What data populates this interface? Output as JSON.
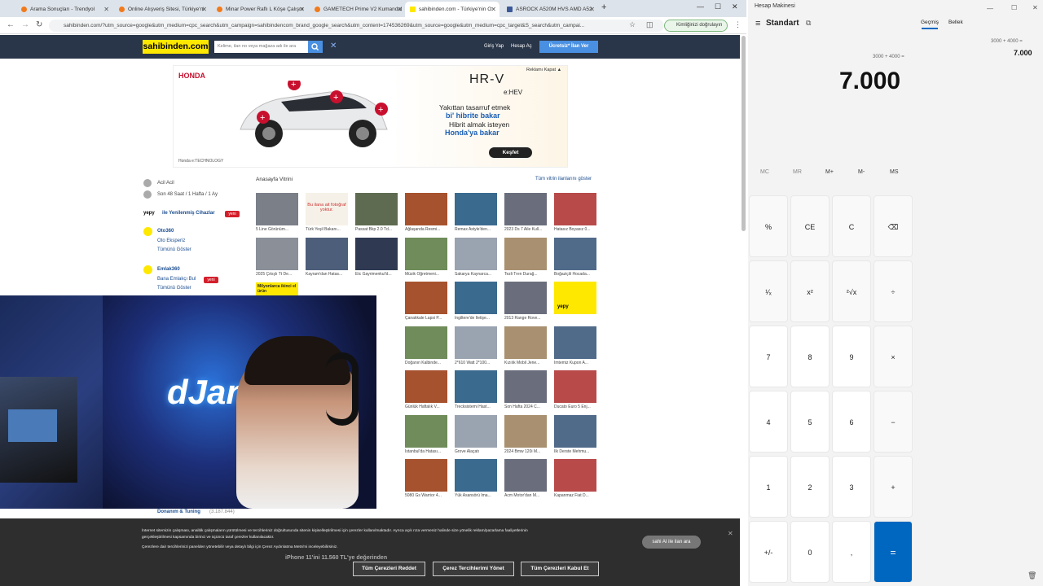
{
  "browser": {
    "tabs": [
      {
        "label": "Arama Sonuçları - Trendyol",
        "color": "#f27a1a"
      },
      {
        "label": "Online Alışveriş Sitesi, Türkiye'ni",
        "color": "#f27a1a"
      },
      {
        "label": "Minar Power Raflı L Köşe Çalışm",
        "color": "#f27a1a"
      },
      {
        "label": "GAMETECH Prime V2 Kumandal",
        "color": "#f27a1a"
      },
      {
        "label": "sahibinden.com - Türkiye'nin O",
        "color": "#ffe800"
      },
      {
        "label": "ASROCK A520M HVS AMD A52",
        "color": "#3b5998"
      }
    ],
    "url": "sahibinden.com/?utm_source=google&utm_medium=cpc_search&utm_campaign=sahibindencom_brand_google_search&utm_content=174536269&utm_source=google&utm_medium=cpc_target&S_search&utm_campai...",
    "profile_label": "Kimliğinizi doğrulayın"
  },
  "site": {
    "logo": "sahibinden.com",
    "search_placeholder": "Kelime, ilan no veya mağaza adı ile ara",
    "login": "Giriş Yap",
    "register": "Hesap Aç",
    "post_ad": "Ücretsiz* İlan Ver",
    "ad": {
      "brand": "HONDA",
      "model": "HR-V",
      "hev": "e:HEV",
      "line1": "Yakıttan tasarruf etmek",
      "line2": "bi' hibrite bakar",
      "line3": "Hibrit almak isteyen",
      "line4": "Honda'ya bakar",
      "cta": "Keşfet",
      "close": "Reklamı Kapat ▲",
      "footer": "Honda e:TECHNOLOGY"
    },
    "nav": {
      "urgent": "Acil Acil",
      "recent": "Son 48 Saat / 1 Hafta / 1 Ay",
      "yepy": "ile Yenilenmiş Cihazlar",
      "new_badge": "yeni",
      "oto360": "Oto360",
      "oto_sub": "Oto Eksperiz",
      "show_all": "Tümünü Göster",
      "emlak360": "Emlak360",
      "emlak_sub": "Bana Emlakçı Bul",
      "show_all2": "Tümünü Göster",
      "milyon": "Milyonlarca ikinci el ürün",
      "donanim": "Donanım & Tuning",
      "donanim_count": "(3.187.844)"
    },
    "showcase_title": "Anasayfa Vitrini",
    "showcase_all": "Tüm vitrin ilanlarını göster",
    "captions": [
      [
        "5 Line Görünüm...",
        "Türk Yeşil Bakanı...",
        "Passat Bkp 2.0 Td...",
        "Ağlaşanda Resmi...",
        "Remax Astyle'den...",
        "2023 Ds 7 Aile Kull...",
        "Hatasız Boyasız 0..."
      ],
      [
        "2025 Çıkışlı Tt De...",
        "Kayram'dan Hatas...",
        "Etc Gayrimenkul'd...",
        "Müzik Öğretmeni...",
        "Sakarya Kaynarca...",
        "Tezli Tren Durağ...",
        "Boğaziçili Hocada..."
      ],
      [
        "",
        "",
        "",
        "Çanakkale Lapsi P...",
        "İngiltere'de İletişe...",
        "2013 Range Rove...",
        ""
      ],
      [
        "",
        "",
        "",
        "Doğanın Kalbinde...",
        "2*610 Watt 2*100...",
        "Kızılık Mobil Jene...",
        "İmtemiz Kupon A..."
      ],
      [
        "",
        "",
        "",
        "Günlük Haftalık V...",
        "Trecksistemi Hast...",
        "Son Hafta 2024 C...",
        "Ducato Euro 5 Enj..."
      ],
      [
        "",
        "",
        "",
        "İstanbul'da Hatası...",
        "Grove Alaçatı",
        "2024 Bmw 120i M...",
        "İlk Derste Mehmu..."
      ],
      [
        "",
        "",
        "",
        "5080 Gs Warrior 4...",
        "Yük Asansörü İma...",
        "Acm Motor'dan M...",
        "Kapanmaz Fiat D..."
      ]
    ],
    "placeholder_text": "Bu ilana ait fotoğraf yoktur.",
    "yepy": "yepy"
  },
  "cookie": {
    "text1": "İnternet sitemizin çalışması, analitik çalışmaların yürütülmesi ve tercihleriniz doğrultusunda sitenin kişiselleştirilmesi için çerezler kullanılmaktadır. Ayrıca açık rıza vermeniz halinde size yönelik reklam/pazarlama faaliyetlerinin",
    "text2": "gerçekleştirilmesi kapsamında birinci ve üçüncü taraf çerezler kullanılacaktır.",
    "text3": "Çerezlere dair tercihlerinizi panelden yönetebilir veya detaylı bilgi için Çerez Aydınlatma Metni'ni inceleyebilirsiniz.",
    "reject": "Tüm Çerezleri Reddet",
    "manage": "Çerez Tercihlerimi Yönet",
    "accept": "Tüm Çerezleri Kabul Et",
    "iphone": "iPhone 11'ini 11.560 TL'ye değerinden",
    "bubble": "sahi AI ile ilan ara"
  },
  "webcam": {
    "name": "dJan"
  },
  "calculator": {
    "title": "Hesap Makinesi",
    "mode": "Standart",
    "history_tab": "Geçmiş",
    "memory_tab": "Bellek",
    "history_expr": "3000 + 4000 =",
    "history_result": "7.000",
    "expression": "3000 + 4000 =",
    "display": "7.000",
    "mem_keys": [
      "MC",
      "MR",
      "M+",
      "M-",
      "MS"
    ],
    "keys": [
      [
        "%",
        "CE",
        "C",
        "⌫"
      ],
      [
        "¹⁄ₓ",
        "x²",
        "²√x",
        "÷"
      ],
      [
        "7",
        "8",
        "9",
        "×"
      ],
      [
        "4",
        "5",
        "6",
        "−"
      ],
      [
        "1",
        "2",
        "3",
        "+"
      ],
      [
        "+/-",
        "0",
        ",",
        "="
      ]
    ]
  }
}
